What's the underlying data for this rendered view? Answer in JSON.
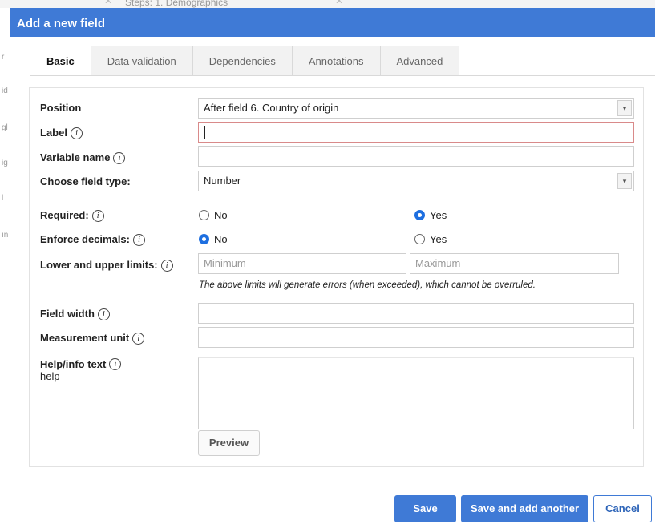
{
  "background": {
    "steps_text": "Steps: 1. Demographics",
    "left_letters": [
      "r",
      "id",
      "gl",
      "ig",
      "l",
      "ın"
    ]
  },
  "dialog": {
    "title": "Add a new field"
  },
  "tabs": [
    {
      "label": "Basic",
      "active": true
    },
    {
      "label": "Data validation",
      "active": false
    },
    {
      "label": "Dependencies",
      "active": false
    },
    {
      "label": "Annotations",
      "active": false
    },
    {
      "label": "Advanced",
      "active": false
    }
  ],
  "form": {
    "position": {
      "label": "Position",
      "value": "After field 6. Country of origin"
    },
    "label_field": {
      "label": "Label",
      "value": ""
    },
    "variable_name": {
      "label": "Variable name",
      "value": ""
    },
    "field_type": {
      "label": "Choose field type:",
      "value": "Number"
    },
    "required": {
      "label": "Required:",
      "option_no": "No",
      "option_yes": "Yes",
      "selected": "Yes"
    },
    "enforce_decimals": {
      "label": "Enforce decimals:",
      "option_no": "No",
      "option_yes": "Yes",
      "selected": "No"
    },
    "limits": {
      "label": "Lower and upper limits:",
      "min_placeholder": "Minimum",
      "max_placeholder": "Maximum",
      "note": "The above limits will generate errors (when exceeded), which cannot be overruled."
    },
    "field_width": {
      "label": "Field width",
      "value": ""
    },
    "measurement_unit": {
      "label": "Measurement unit",
      "value": ""
    },
    "help_text": {
      "label": "Help/info text",
      "help_link": "help",
      "value": ""
    },
    "preview_label": "Preview"
  },
  "icons": {
    "info": "i",
    "dropdown": "▾"
  },
  "buttons": {
    "save": "Save",
    "save_add": "Save and add another",
    "cancel": "Cancel"
  },
  "colors": {
    "accent": "#3f7ad6",
    "error_border": "#d98a8a",
    "radio_selected": "#1e6fe0"
  }
}
